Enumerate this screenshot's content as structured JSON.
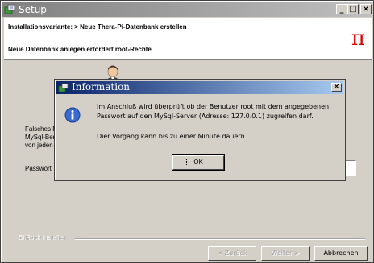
{
  "window": {
    "title": "Setup",
    "minimize_glyph": "_",
    "maximize_glyph": "□",
    "close_glyph": "×"
  },
  "header": {
    "install_variant": "Installationsvariante: > Neue Thera-Pi-Datenbank erstellen",
    "subtitle": "Neue Datenbank anlegen erfordert root-Rechte",
    "logo_glyph": "π",
    "logo_color": "#e00000"
  },
  "content": {
    "label_line1": "Falsches P",
    "label_line2": "MySql-Ber",
    "label_line3": "von jeden",
    "password_label": "Passwort"
  },
  "footer": {
    "installer_brand": "BitRock Installer",
    "back_label": "< Zurück",
    "next_label": "Weiter >",
    "cancel_label": "Abbrechen"
  },
  "dialog": {
    "title": "Information",
    "close_glyph": "×",
    "message_line1": "Im Anschluß wird überprüft ob der Benutzer root mit dem angegebenen",
    "message_line2": "Passwort auf den MySql-Server (Adresse: 127.0.0.1) zugreifen darf.",
    "message_line3": "Dier Vorgang kann bis zu einer Minute dauern.",
    "ok_label": "OK",
    "icon": "info-icon"
  },
  "colors": {
    "window_bg": "#d4d0c8",
    "active_title_start": "#0a246a",
    "active_title_end": "#a6caf0",
    "inactive_title_start": "#808080",
    "inactive_title_end": "#c0c0c0"
  }
}
